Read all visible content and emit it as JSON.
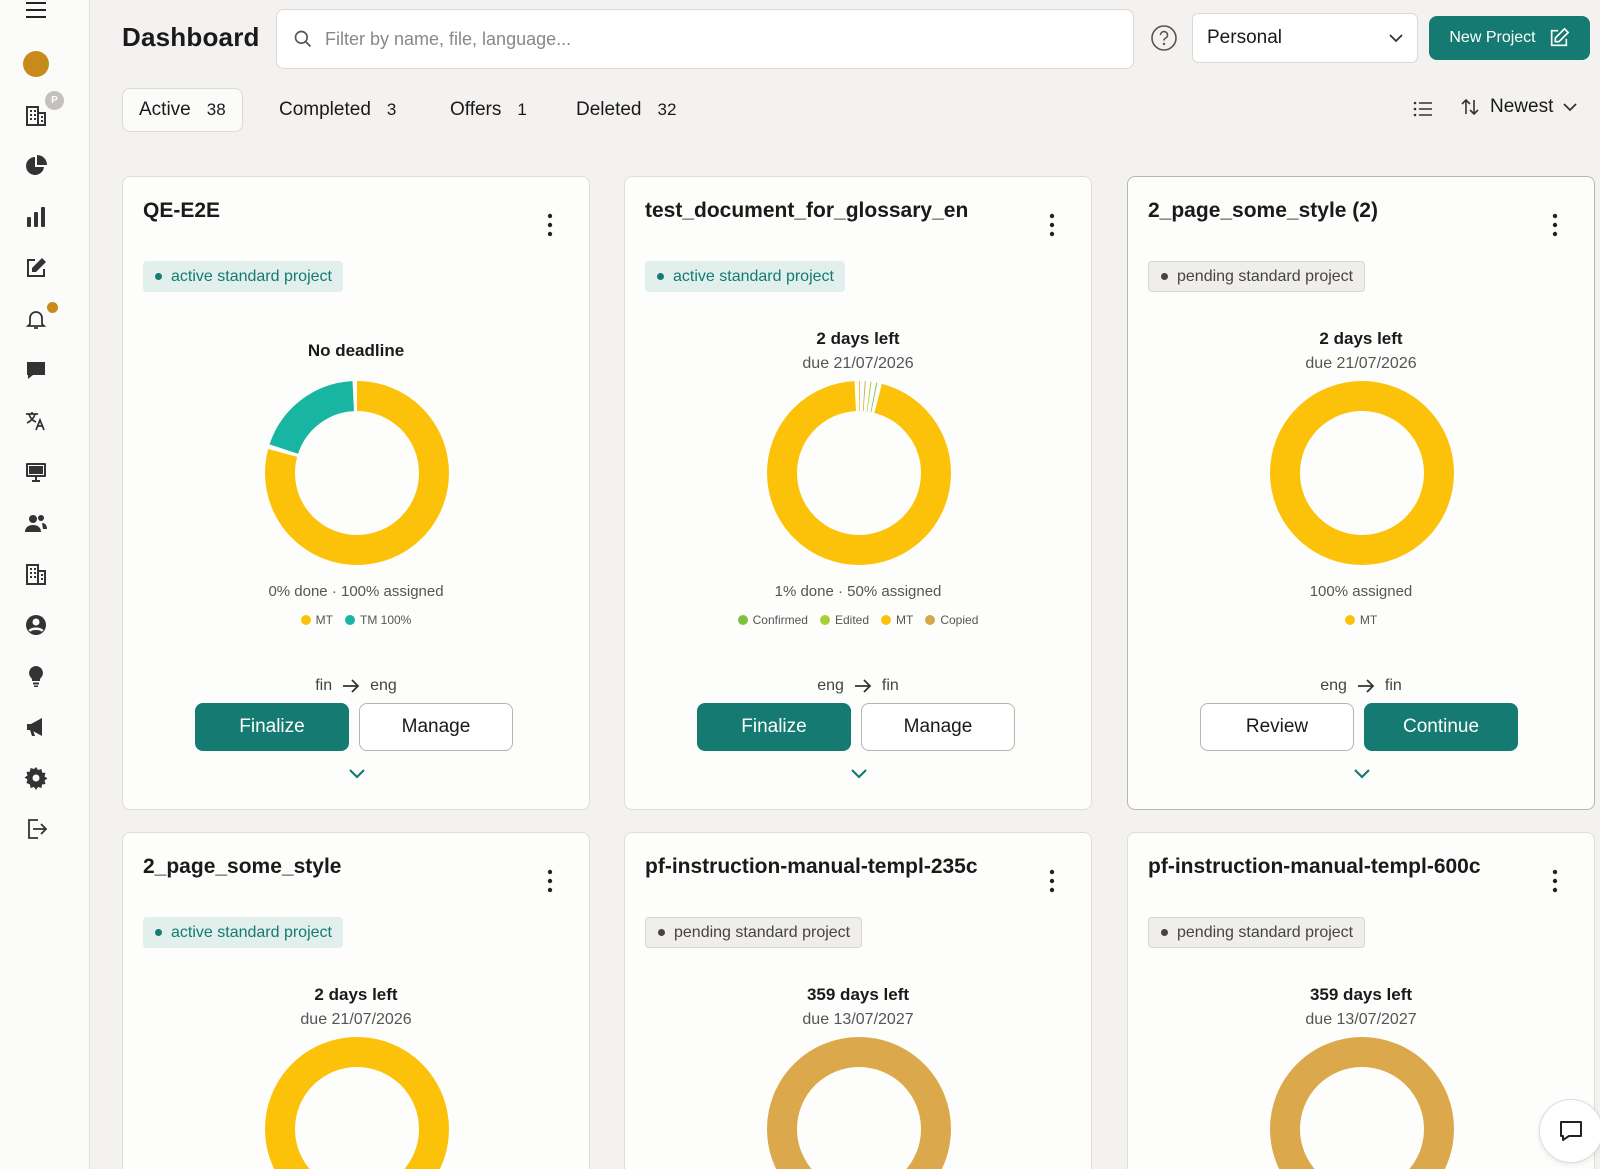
{
  "header": {
    "title": "Dashboard",
    "search_placeholder": "Filter by name, file, language...",
    "workspace": "Personal",
    "new_project": "New Project"
  },
  "sidebar": {
    "badge_letter": "P",
    "items": [
      "menu-icon",
      "avatar",
      "building-icon",
      "pie-chart-icon",
      "bar-chart-icon",
      "edit-icon",
      "bell-icon",
      "chat-icon",
      "translate-icon",
      "monitor-icon",
      "users-icon",
      "building-icon",
      "user-circle-icon",
      "lightbulb-icon",
      "megaphone-icon",
      "gear-icon",
      "logout-icon"
    ]
  },
  "tabs": [
    {
      "label": "Active",
      "count": "38"
    },
    {
      "label": "Completed",
      "count": "3"
    },
    {
      "label": "Offers",
      "count": "1"
    },
    {
      "label": "Deleted",
      "count": "32"
    }
  ],
  "sort": {
    "label": "Newest"
  },
  "colors": {
    "accent": "#157a72",
    "mt": "#fcc20a",
    "tm": "#18b5a3",
    "confirmed": "#7cc242",
    "edited": "#a8d038",
    "copied": "#d9a74a",
    "pending_ring": "#dba94b"
  },
  "cards": [
    {
      "title": "QE-E2E",
      "status": "active standard project",
      "status_type": "active",
      "deadline": "No deadline",
      "due": "",
      "progress": "0% done · 100% assigned",
      "legend": [
        {
          "label": "MT",
          "color": "#fcc20a"
        },
        {
          "label": "TM 100%",
          "color": "#18b5a3"
        }
      ],
      "segments": [
        {
          "value": 80,
          "color": "#fcc20a"
        },
        {
          "value": 20,
          "color": "#18b5a3"
        }
      ],
      "source": "fin",
      "target": "eng",
      "buttons": [
        {
          "label": "Finalize",
          "type": "primary"
        },
        {
          "label": "Manage",
          "type": "secondary"
        }
      ]
    },
    {
      "title": "test_document_for_glossary_en",
      "status": "active standard project",
      "status_type": "active",
      "deadline": "2 days left",
      "due": "due 21/07/2026",
      "progress": "1% done · 50% assigned",
      "legend": [
        {
          "label": "Confirmed",
          "color": "#7cc242"
        },
        {
          "label": "Edited",
          "color": "#a8d038"
        },
        {
          "label": "MT",
          "color": "#fcc20a"
        },
        {
          "label": "Copied",
          "color": "#d9a74a"
        }
      ],
      "segments": [
        {
          "value": 1,
          "color": "#fcc20a"
        },
        {
          "value": 1,
          "color": "#d9a74a"
        },
        {
          "value": 1,
          "color": "#a8d038"
        },
        {
          "value": 1,
          "color": "#7cc242"
        },
        {
          "value": 96,
          "color": "#fcc20a"
        }
      ],
      "source": "eng",
      "target": "fin",
      "buttons": [
        {
          "label": "Finalize",
          "type": "primary"
        },
        {
          "label": "Manage",
          "type": "secondary"
        }
      ]
    },
    {
      "title": "2_page_some_style (2)",
      "status": "pending standard project",
      "status_type": "pending",
      "deadline": "2 days left",
      "due": "due 21/07/2026",
      "progress": "100% assigned",
      "legend": [
        {
          "label": "MT",
          "color": "#fcc20a"
        }
      ],
      "segments": [
        {
          "value": 100,
          "color": "#fcc20a"
        }
      ],
      "source": "eng",
      "target": "fin",
      "buttons": [
        {
          "label": "Review",
          "type": "secondary"
        },
        {
          "label": "Continue",
          "type": "primary"
        }
      ]
    },
    {
      "title": "2_page_some_style",
      "status": "active standard project",
      "status_type": "active",
      "deadline": "2 days left",
      "due": "due 21/07/2026",
      "segments": [
        {
          "value": 100,
          "color": "#fcc20a"
        }
      ]
    },
    {
      "title": "pf-instruction-manual-templ-235c",
      "status": "pending standard project",
      "status_type": "pending",
      "deadline": "359 days left",
      "due": "due 13/07/2027",
      "segments": [
        {
          "value": 100,
          "color": "#dba94b"
        }
      ]
    },
    {
      "title": "pf-instruction-manual-templ-600c",
      "status": "pending standard project",
      "status_type": "pending",
      "deadline": "359 days left",
      "due": "due 13/07/2027",
      "segments": [
        {
          "value": 100,
          "color": "#dba94b"
        }
      ]
    }
  ]
}
